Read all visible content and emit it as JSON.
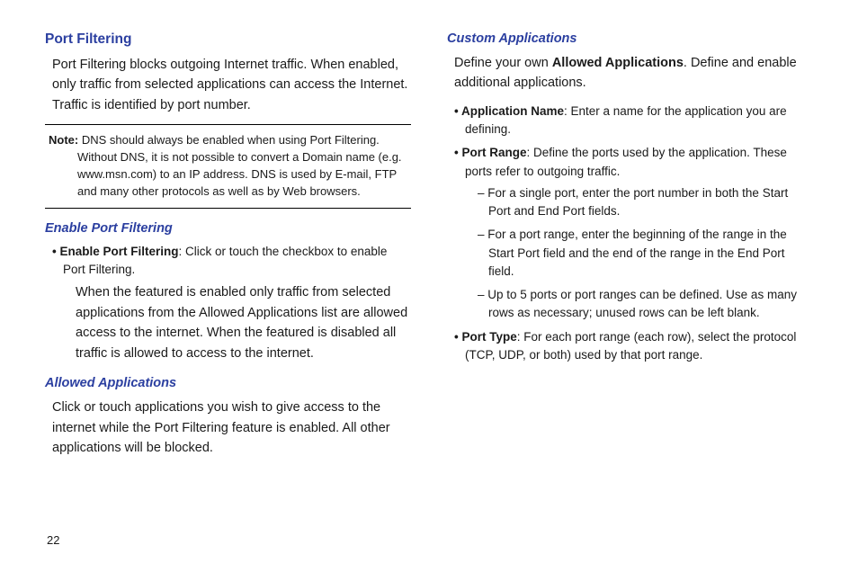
{
  "pageNumber": "22",
  "left": {
    "h3": "Port Filtering",
    "intro": "Port Filtering blocks outgoing Internet traffic. When enabled, only traffic from selected applications can access the Internet. Traffic is identified by port number.",
    "noteLabel": "Note:",
    "noteBody": " DNS should always be enabled when using Port Filtering. Without DNS, it is not possible to convert a Domain name (e.g. www.msn.com) to an IP address. DNS is used by E-mail, FTP and many other protocols as well as by Web browsers.",
    "sec1": {
      "h4": "Enable Port Filtering",
      "bulletLabel": "Enable Port Filtering",
      "bulletRest": ": Click or touch the checkbox to enable Port Filtering.",
      "sub": "When the featured is enabled only traffic from selected applications from the Allowed Applications list are allowed access to the internet. When the featured is disabled all traffic is allowed to access to the internet."
    },
    "sec2": {
      "h4": "Allowed Applications",
      "body": "Click or touch applications you wish to give access to the internet while the Port Filtering feature is enabled. All other applications will be blocked."
    }
  },
  "right": {
    "h4": "Custom Applications",
    "introPre": "Define your own ",
    "introBold": "Allowed Applications",
    "introPost": ". Define and enable additional applications.",
    "b1": {
      "label": "Application Name",
      "rest": ": Enter a name for the application you are defining."
    },
    "b2": {
      "label": "Port Range",
      "rest": ": Define the ports used by the application. These ports refer to outgoing traffic.",
      "d1": "For a single port, enter the port number in both the Start Port and End Port fields.",
      "d2": "For a port range, enter the beginning of the range in the Start Port field and the end of the range in the End Port field.",
      "d3": "Up to 5 ports or port ranges can be defined. Use as many rows as necessary; unused rows can be left blank."
    },
    "b3": {
      "label": "Port Type",
      "rest": ": For each port range (each row), select the protocol (TCP, UDP, or both) used by that port range."
    }
  }
}
